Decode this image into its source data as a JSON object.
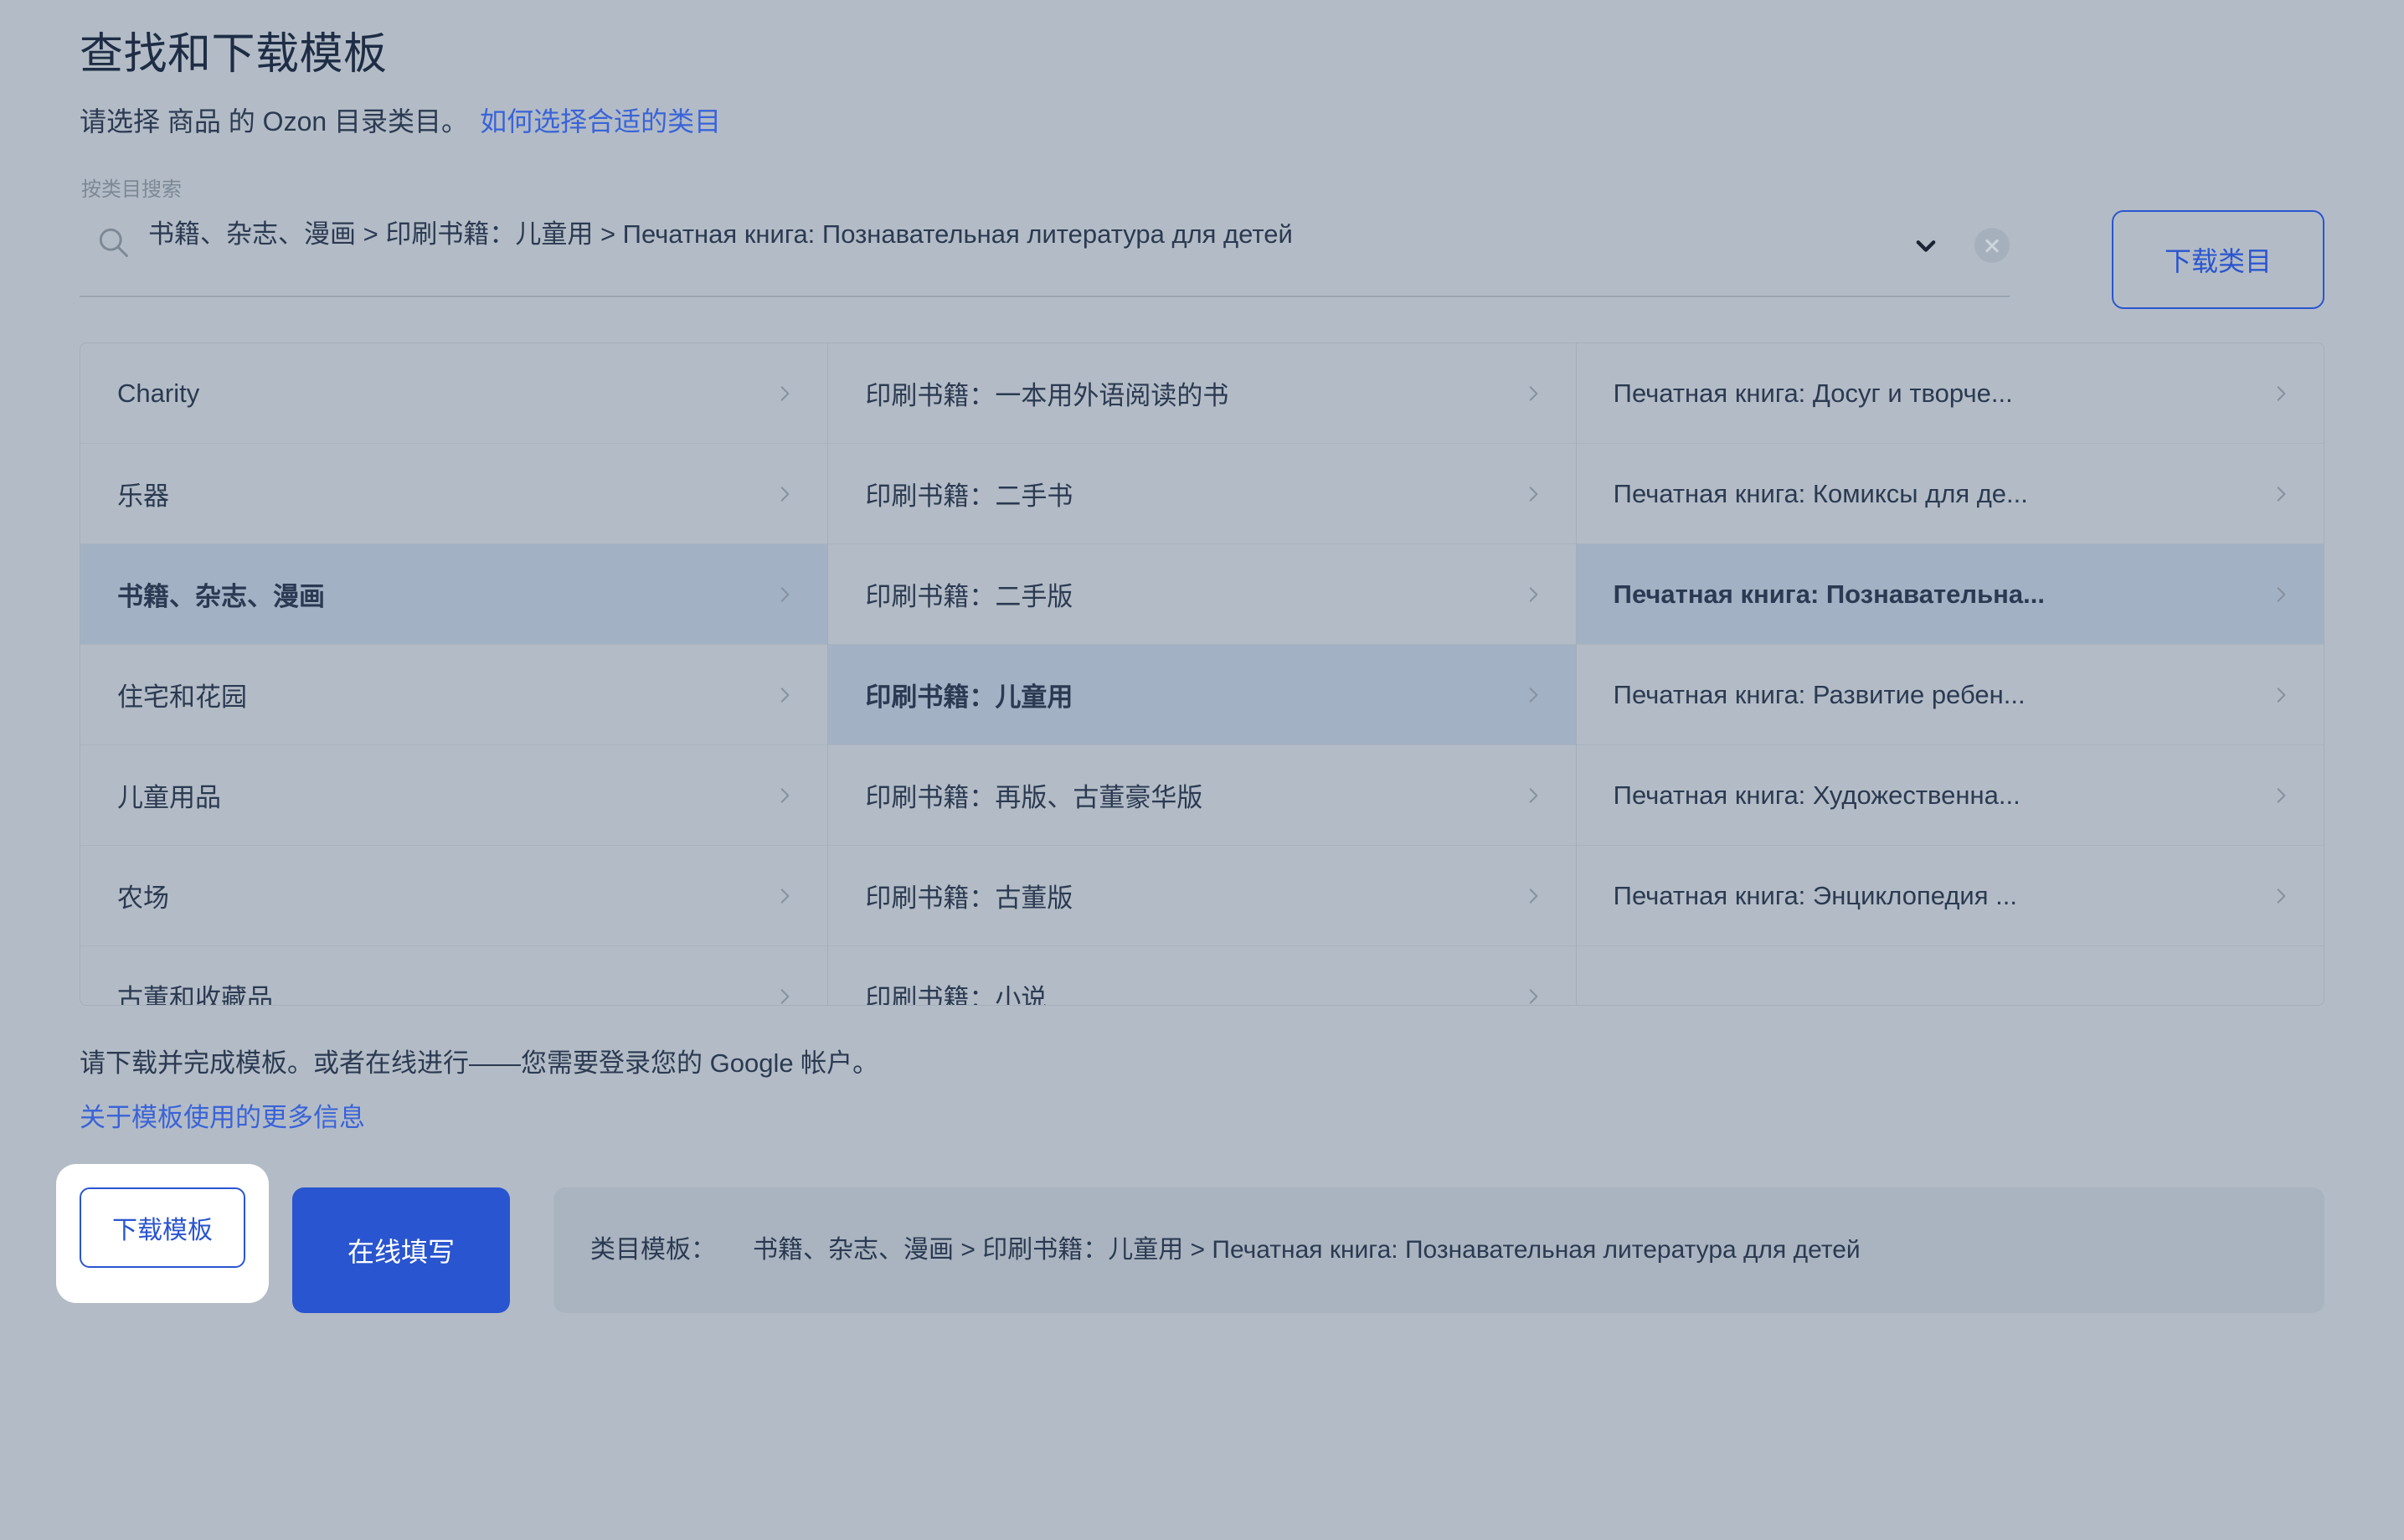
{
  "header": {
    "title": "查找和下载模板",
    "subtitle_text": "请选择 商品 的 Ozon 目录类目。",
    "subtitle_link": "如何选择合适的类目"
  },
  "search": {
    "label": "按类目搜索",
    "value": "书籍、杂志、漫画 > 印刷书籍：儿童用 > Печатная книга: Познавательная литература для детей",
    "icon": "search-icon",
    "caret_icon": "chevron-down-icon",
    "clear_icon": "clear-circle-icon",
    "download_category_label": "下载类目"
  },
  "picker": {
    "columns": [
      {
        "name": "level-1",
        "rows": [
          {
            "label": "Charity",
            "selected": false
          },
          {
            "label": "乐器",
            "selected": false
          },
          {
            "label": "书籍、杂志、漫画",
            "selected": true
          },
          {
            "label": "住宅和花园",
            "selected": false
          },
          {
            "label": "儿童用品",
            "selected": false
          },
          {
            "label": "农场",
            "selected": false
          },
          {
            "label": "古董和收藏品",
            "selected": false
          }
        ]
      },
      {
        "name": "level-2",
        "rows": [
          {
            "label": "印刷书籍：一本用外语阅读的书",
            "selected": false
          },
          {
            "label": "印刷书籍：二手书",
            "selected": false
          },
          {
            "label": "印刷书籍：二手版",
            "selected": false
          },
          {
            "label": "印刷书籍：儿童用",
            "selected": true
          },
          {
            "label": "印刷书籍：再版、古董豪华版",
            "selected": false
          },
          {
            "label": "印刷书籍：古董版",
            "selected": false
          },
          {
            "label": "印刷书籍：小说",
            "selected": false
          }
        ]
      },
      {
        "name": "level-3",
        "rows": [
          {
            "label": "Печатная книга: Досуг и творче...",
            "selected": false
          },
          {
            "label": "Печатная книга: Комиксы для де...",
            "selected": false
          },
          {
            "label": "Печатная книга: Познавательна...",
            "selected": true
          },
          {
            "label": "Печатная книга: Развитие ребен...",
            "selected": false
          },
          {
            "label": "Печатная книга: Художественна...",
            "selected": false
          },
          {
            "label": "Печатная книга: Энциклопедия ...",
            "selected": false
          },
          {
            "label": "",
            "selected": false,
            "empty": true
          }
        ]
      }
    ],
    "chevron_icon": "chevron-right-icon"
  },
  "footer": {
    "note": "请下载并完成模板。或者在线进行——您需要登录您的 Google 帐户。",
    "link": "关于模板使用的更多信息"
  },
  "actions": {
    "download_template_label": "下载模板",
    "fill_online_label": "在线填写",
    "template_info_label": "类目模板：",
    "template_info_value": "书籍、杂志、漫画 > 印刷书籍：儿童用 > Печатная книга: Познавательная литература для детей"
  },
  "colors": {
    "page_bg": "#b3bcc6",
    "accent_blue": "#2a55d0",
    "link_blue": "#3a63d8",
    "text": "#2b3a52",
    "row_selected_bg": "#a3b1c4",
    "muted": "#7d8896"
  }
}
